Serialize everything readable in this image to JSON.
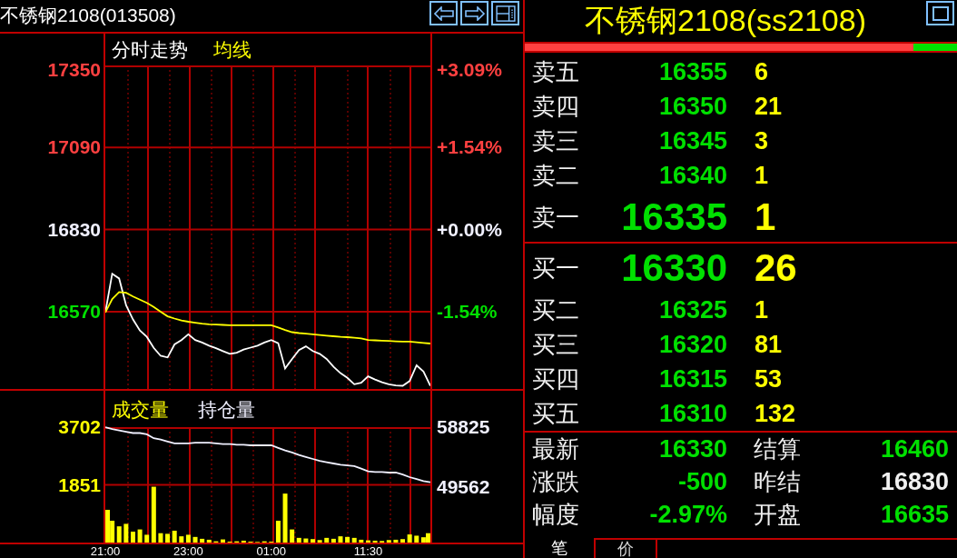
{
  "chart_panel": {
    "title": "不锈钢2108(013508)",
    "price_chart": {
      "right_axis": [
        {
          "label": "+3.09%",
          "color": "#ff4040"
        },
        {
          "label": "+1.54%",
          "color": "#ff4040"
        },
        {
          "label": "+0.00%",
          "color": "#f0f0ff"
        },
        {
          "label": "-1.54%",
          "color": "#00e000"
        }
      ],
      "chart_data": {
        "type": "line",
        "categories": [
          null,
          null,
          null,
          null,
          null,
          null,
          null,
          null,
          null,
          null,
          null,
          null,
          null,
          null,
          null,
          null,
          null,
          null,
          null,
          null,
          null,
          null,
          null,
          null,
          null,
          null,
          null,
          null,
          null,
          null,
          null,
          null,
          null,
          null,
          null,
          null,
          null,
          null,
          null,
          null,
          null,
          null,
          null,
          null,
          null,
          null,
          null,
          null
        ],
        "ylim": [
          16325,
          17350
        ],
        "yticks": [
          17350,
          17090,
          16830,
          16570
        ],
        "grid": true,
        "series": [
          {
            "name": "分时走势",
            "color": "#ffffff",
            "values": [
              16567,
              16690,
              16675,
              16590,
              16545,
              16510,
              16490,
              16455,
              16430,
              16425,
              16466,
              16480,
              16498,
              16480,
              16472,
              16462,
              16454,
              16445,
              16436,
              16440,
              16450,
              16456,
              16462,
              16472,
              16480,
              16470,
              16390,
              16420,
              16448,
              16460,
              16445,
              16436,
              16420,
              16395,
              16375,
              16360,
              16340,
              16345,
              16365,
              16355,
              16346,
              16340,
              16336,
              16335,
              16350,
              16400,
              16380,
              16335
            ]
          },
          {
            "name": "均线",
            "color": "#ffff00",
            "values": [
              16567,
              16610,
              16632,
              16630,
              16618,
              16608,
              16598,
              16585,
              16570,
              16555,
              16548,
              16542,
              16538,
              16535,
              16532,
              16530,
              16529,
              16528,
              16527,
              16527,
              16527,
              16527,
              16527,
              16527,
              16527,
              16520,
              16512,
              16505,
              16502,
              16500,
              16498,
              16496,
              16494,
              16492,
              16490,
              16489,
              16487,
              16485,
              16480,
              16479,
              16478,
              16477,
              16476,
              16475,
              16475,
              16473,
              16471,
              16469
            ]
          }
        ]
      }
    },
    "volume_chart": {
      "chart_data": {
        "type": "bar",
        "categories": [
          "21:00",
          null,
          null,
          null,
          null,
          null,
          null,
          null,
          null,
          null,
          null,
          null,
          "23:00",
          null,
          null,
          null,
          null,
          null,
          null,
          null,
          null,
          null,
          null,
          null,
          "01:00",
          null,
          null,
          null,
          null,
          null,
          null,
          null,
          null,
          null,
          null,
          null,
          null,
          null,
          "11:30",
          null,
          null,
          null,
          null,
          null,
          null,
          null,
          null,
          null
        ],
        "ylim": [
          0,
          3702
        ],
        "yticks": [
          3702,
          1851
        ],
        "grid": true,
        "series": [
          {
            "name": "成交量",
            "color": "#ffff00",
            "values": [
              1050,
              700,
              520,
              600,
              350,
              420,
              250,
              1790,
              300,
              280,
              380,
              200,
              250,
              180,
              120,
              90,
              40,
              100,
              30,
              40,
              60,
              30,
              20,
              40,
              30,
              700,
              1570,
              420,
              150,
              130,
              110,
              80,
              150,
              120,
              200,
              180,
              150,
              90,
              70,
              60,
              50,
              80,
              90,
              110,
              260,
              220,
              170,
              300
            ]
          }
        ]
      }
    },
    "open_interest_chart": {
      "chart_data": {
        "type": "line",
        "categories": [
          null,
          null,
          null,
          null,
          null,
          null,
          null,
          null,
          null,
          null,
          null,
          null,
          null,
          null,
          null,
          null,
          null,
          null,
          null,
          null,
          null,
          null,
          null,
          null,
          null,
          null,
          null,
          null,
          null,
          null,
          null,
          null,
          null,
          null,
          null,
          null,
          null,
          null,
          null,
          null,
          null,
          null,
          null,
          null,
          null,
          null,
          null,
          null
        ],
        "ylim": [
          41000,
          64700
        ],
        "yticks": [
          58825,
          49562
        ],
        "series": [
          {
            "name": "持仓量",
            "color": "#f0f0ff",
            "values": [
              58800,
              58500,
              58300,
              58100,
              57900,
              57900,
              57700,
              57100,
              56900,
              56600,
              56300,
              56300,
              56300,
              56400,
              56400,
              56400,
              56300,
              56200,
              56200,
              56100,
              56100,
              56000,
              56000,
              56000,
              56000,
              55600,
              55200,
              54900,
              54500,
              54200,
              53900,
              53600,
              53400,
              53200,
              53000,
              52900,
              52800,
              52400,
              52000,
              51900,
              51900,
              51800,
              51800,
              51500,
              51100,
              50800,
              50500,
              50300
            ]
          }
        ]
      }
    }
  },
  "quote_panel": {
    "title": "不锈钢2108(ss2108)",
    "ratio_bar": {
      "level": 0.9
    },
    "asks": [
      {
        "label": "卖五",
        "price": "16355",
        "volume": "6"
      },
      {
        "label": "卖四",
        "price": "16350",
        "volume": "21"
      },
      {
        "label": "卖三",
        "price": "16345",
        "volume": "3"
      },
      {
        "label": "卖二",
        "price": "16340",
        "volume": "1"
      },
      {
        "label": "卖一",
        "price": "16335",
        "volume": "1"
      }
    ],
    "bids": [
      {
        "label": "买一",
        "price": "16330",
        "volume": "26"
      },
      {
        "label": "买二",
        "price": "16325",
        "volume": "1"
      },
      {
        "label": "买三",
        "price": "16320",
        "volume": "81"
      },
      {
        "label": "买四",
        "price": "16315",
        "volume": "53"
      },
      {
        "label": "买五",
        "price": "16310",
        "volume": "132"
      }
    ],
    "stats": [
      {
        "label": "最新",
        "value": "16330",
        "color": "#00e000"
      },
      {
        "label": "结算",
        "value": "16460",
        "color": "#00e000"
      },
      {
        "label": "涨跌",
        "value": "-500",
        "color": "#00e000"
      },
      {
        "label": "昨结",
        "value": "16830",
        "color": "#f0f0f0"
      },
      {
        "label": "幅度",
        "value": "-2.97%",
        "color": "#00e000"
      },
      {
        "label": "开盘",
        "value": "16635",
        "color": "#00e000"
      }
    ],
    "tabs": [
      {
        "label": "笔",
        "selected": true
      },
      {
        "label": "价",
        "selected": false
      }
    ]
  }
}
